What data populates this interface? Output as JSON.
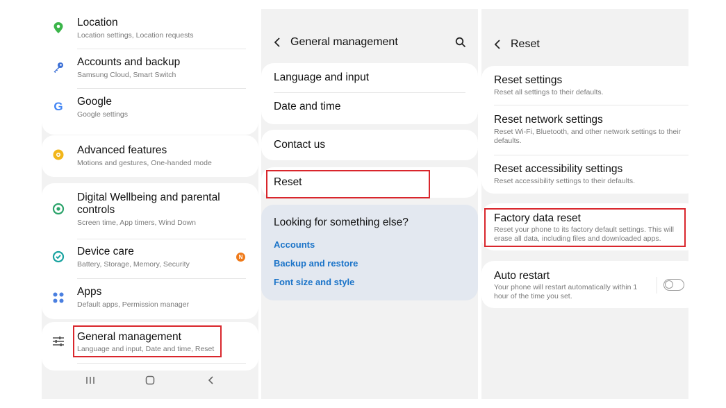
{
  "settings": {
    "location": {
      "title": "Location",
      "sub": "Location settings, Location requests"
    },
    "accounts": {
      "title": "Accounts and backup",
      "sub": "Samsung Cloud, Smart Switch"
    },
    "google": {
      "title": "Google",
      "sub": "Google settings",
      "icon_glyph": "G"
    },
    "advanced": {
      "title": "Advanced features",
      "sub": "Motions and gestures, One-handed mode"
    },
    "wellbeing": {
      "title_line1": "Digital Wellbeing and parental",
      "title_line2": "controls",
      "sub": "Screen time, App timers, Wind Down"
    },
    "devicecare": {
      "title": "Device care",
      "sub": "Battery, Storage, Memory, Security",
      "badge": "N"
    },
    "apps": {
      "title": "Apps",
      "sub": "Default apps, Permission manager"
    },
    "general": {
      "title": "General management",
      "sub": "Language and input, Date and time, Reset"
    }
  },
  "general_management": {
    "header": "General management",
    "items": {
      "language": "Language and input",
      "datetime": "Date and time",
      "contact": "Contact us",
      "reset": "Reset"
    },
    "suggest": {
      "title": "Looking for something else?",
      "links": [
        "Accounts",
        "Backup and restore",
        "Font size and style"
      ]
    }
  },
  "reset": {
    "header": "Reset",
    "items": {
      "settings": {
        "title": "Reset settings",
        "sub": "Reset all settings to their defaults."
      },
      "network": {
        "title": "Reset network settings",
        "sub1": "Reset Wi-Fi, Bluetooth, and other network settings to their",
        "sub2": "defaults."
      },
      "accessibility": {
        "title": "Reset accessibility settings",
        "sub": "Reset accessibility settings to their defaults."
      },
      "factory": {
        "title": "Factory data reset",
        "sub1": "Reset your phone to its factory default settings. This will",
        "sub2": "erase all data, including files and downloaded apps."
      },
      "autorestart": {
        "title": "Auto restart",
        "sub1": "Your phone will restart automatically within 1",
        "sub2": "hour of the time you set.",
        "toggle_on": false
      }
    }
  },
  "colors": {
    "highlight": "#d9262c",
    "link": "#1a73c8",
    "location_icon": "#3bb54a",
    "accounts_icon": "#3b6fd6",
    "advanced_icon": "#f2b61a",
    "wellbeing_icon": "#2ba36a",
    "devicecare_icon": "#19a3a0",
    "apps_icon": "#4a7fe0",
    "badge": "#ef7a1a"
  }
}
